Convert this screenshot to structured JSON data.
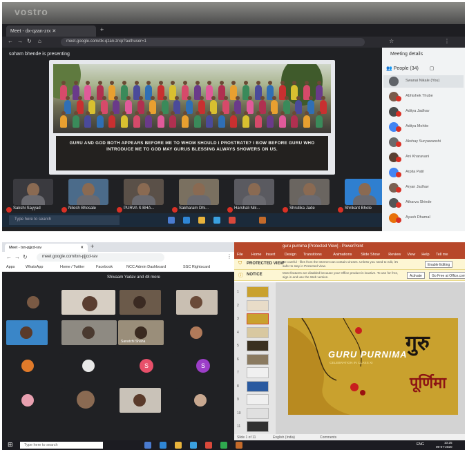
{
  "top": {
    "brand": "vostro",
    "tab_label": "Meet - dx-qzan-zrx",
    "url": "meet.google.com/dx-qzan-zrxp?authuser=1",
    "presenting": "soham bhende is presenting",
    "slide_caption": "GURU AND GOD BOTH APPEARS BEFORE ME TO WHOM SHOULD I PROSTRATE? I BOW BEFORE GURU WHO INTRODUCE ME TO GOD MAY GURUS BLESSING ALWAYS SHOWERS ON US.",
    "film": [
      {
        "label": "Sakshi Sayyad"
      },
      {
        "label": "Nilesh Bhosale"
      },
      {
        "label": "PURVA S BHA..."
      },
      {
        "label": "Sakharam Dhi..."
      },
      {
        "label": "Harshali Nik..."
      },
      {
        "label": "Shrutika Jade"
      },
      {
        "label": "Shrikant Bhole"
      }
    ],
    "taskbar_search": "Type here to search",
    "side_title": "Meeting details",
    "people_label": "People (34)",
    "people": [
      {
        "name": "Swanai Nikale (You)",
        "color": "#5f6368"
      },
      {
        "name": "Abhishek Thube",
        "color": "#7a5b4a"
      },
      {
        "name": "Aditya Jadhav",
        "color": "#4a4a4a"
      },
      {
        "name": "Aditya Mohite",
        "color": "#4285f4"
      },
      {
        "name": "Akshay Suryawanshi",
        "color": "#6a6a6a"
      },
      {
        "name": "Ani Kharavani",
        "color": "#5a4032"
      },
      {
        "name": "Arpita Patil",
        "color": "#4285f4"
      },
      {
        "name": "Aryan Jadhav",
        "color": "#7b6152"
      },
      {
        "name": "Atharva Shinde",
        "color": "#555555"
      },
      {
        "name": "Ayush Dhamal",
        "color": "#e8710a"
      }
    ]
  },
  "bottom_left": {
    "tab_label": "Meet - txn-pjjcd-rav",
    "url": "meet.google.com/txn-pjjcd-rav",
    "bookmarks": [
      "Apps",
      "WhatsApp",
      "Home / Twitter",
      "Facebook",
      "NCC Admin Dashboard",
      "SSC Rightscard"
    ],
    "presenter_name": "Shivaam Yadav and 48 more",
    "tile_name": "Sanatchi Shaha",
    "initials": [
      "S",
      "S"
    ]
  },
  "bottom_right": {
    "title": "guru purnima [Protected View] - PowerPoint",
    "ribbon": [
      "File",
      "Home",
      "Insert",
      "Design",
      "Transitions",
      "Animations",
      "Slide Show",
      "Review",
      "View",
      "Help",
      "Tell me"
    ],
    "protected_label": "PROTECTED VIEW",
    "protected_text": "Be careful - files from the Internet can contain viruses. Unless you need to edit, it's safer to stay in Protected View.",
    "protected_btn": "Enable Editing",
    "notice_label": "NOTICE",
    "notice_text": "Most features are disabled because your Office product is inactive. To use for free, sign in and use the Web version.",
    "notice_btn1": "Activate",
    "notice_btn2": "Go Free at Office.com",
    "slide_numbers": [
      "1",
      "2",
      "3",
      "4",
      "5",
      "6",
      "7",
      "8",
      "9",
      "10",
      "11"
    ],
    "slide_title": "GURU PURNIMA",
    "slide_subtitle": "CELEBRATION IN CLASS XI",
    "dev_top": "गुरु",
    "dev_bottom": "पूर्णिमा",
    "status_slide": "Slide 1 of 11",
    "status_lang": "English (India)",
    "status_comments": "Comments"
  },
  "taskbar": {
    "search": "Type here to search",
    "time": "10:25",
    "date": "09-07-2020",
    "lang": "ENG"
  }
}
